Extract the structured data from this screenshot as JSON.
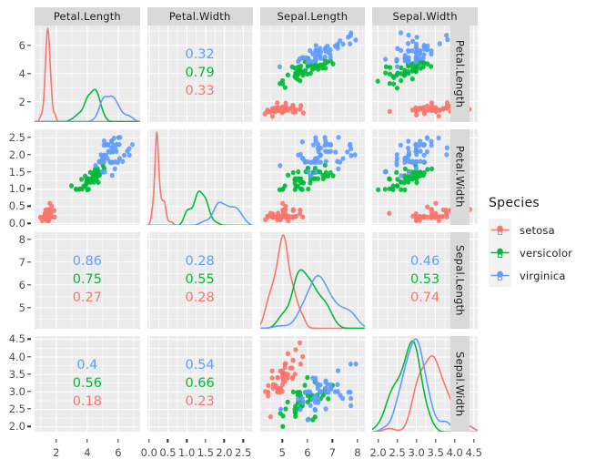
{
  "legend": {
    "title": "Species",
    "items": [
      {
        "label": "setosa",
        "color": "#F8766D"
      },
      {
        "label": "versicolor",
        "color": "#00BA38"
      },
      {
        "label": "virginica",
        "color": "#619CFF"
      }
    ]
  },
  "colors": {
    "setosa": "#F8766D",
    "versicolor": "#00BA38",
    "virginica": "#619CFF",
    "panel_bg": "#EBEBEB",
    "strip_bg": "#D9D9D9",
    "gridline": "#FFFFFF",
    "axis_text": "#4D4D4D"
  },
  "strips": {
    "columns": [
      "Petal.Length",
      "Petal.Width",
      "Sepal.Length",
      "Sepal.Width"
    ],
    "rows": [
      "Petal.Length",
      "Petal.Width",
      "Sepal.Length",
      "Sepal.Width"
    ]
  },
  "axes": {
    "x": [
      {
        "var": "Petal.Length",
        "ticks": [
          "2",
          "4",
          "6"
        ],
        "values": [
          2,
          4,
          6
        ],
        "range": [
          0.6,
          7.4
        ]
      },
      {
        "var": "Petal.Width",
        "ticks": [
          "0.0",
          "0.5",
          "1.0",
          "1.5",
          "2.0",
          "2.5"
        ],
        "values": [
          0.0,
          0.5,
          1.0,
          1.5,
          2.0,
          2.5
        ],
        "range": [
          -0.05,
          2.75
        ]
      },
      {
        "var": "Sepal.Length",
        "ticks": [
          "5",
          "6",
          "7",
          "8"
        ],
        "values": [
          5,
          6,
          7,
          8
        ],
        "range": [
          4.1,
          8.3
        ]
      },
      {
        "var": "Sepal.Width",
        "ticks": [
          "2.0",
          "2.5",
          "3.0",
          "3.5",
          "4.0",
          "4.5"
        ],
        "values": [
          2.0,
          2.5,
          3.0,
          3.5,
          4.0,
          4.5
        ],
        "range": [
          1.85,
          4.6
        ]
      }
    ],
    "y": [
      {
        "var": "Petal.Length",
        "ticks": [
          "2",
          "4",
          "6"
        ],
        "values": [
          2,
          4,
          6
        ],
        "range": [
          0.6,
          7.4
        ]
      },
      {
        "var": "Petal.Width",
        "ticks": [
          "0.0",
          "0.5",
          "1.0",
          "1.5",
          "2.0",
          "2.5"
        ],
        "values": [
          0.0,
          0.5,
          1.0,
          1.5,
          2.0,
          2.5
        ],
        "range": [
          -0.05,
          2.75
        ]
      },
      {
        "var": "Sepal.Length",
        "ticks": [
          "5",
          "6",
          "7",
          "8"
        ],
        "values": [
          5,
          6,
          7,
          8
        ],
        "range": [
          4.1,
          8.3
        ]
      },
      {
        "var": "Sepal.Width",
        "ticks": [
          "2.0",
          "2.5",
          "3.0",
          "3.5",
          "4.0",
          "4.5"
        ],
        "values": [
          2.0,
          2.5,
          3.0,
          3.5,
          4.0,
          4.5
        ],
        "range": [
          1.85,
          4.6
        ]
      }
    ]
  },
  "chart_data": {
    "type": "scatter",
    "title": "",
    "subtitle": "",
    "xlabel": "",
    "ylabel": "",
    "layout": "scatterplot-matrix",
    "grid": true,
    "legend_position": "right",
    "variables": [
      "Petal.Length",
      "Petal.Width",
      "Sepal.Length",
      "Sepal.Width"
    ],
    "groups": [
      "setosa",
      "versicolor",
      "virginica"
    ],
    "panels": [
      {
        "row": 1,
        "col": 1,
        "kind": "density",
        "variable": "Petal.Length"
      },
      {
        "row": 1,
        "col": 2,
        "kind": "correlation",
        "x": "Petal.Width",
        "y": "Petal.Length",
        "values": [
          {
            "group": "virginica",
            "text": "0.32"
          },
          {
            "group": "versicolor",
            "text": "0.79"
          },
          {
            "group": "setosa",
            "text": "0.33"
          }
        ]
      },
      {
        "row": 1,
        "col": 3,
        "kind": "scatter",
        "x": "Sepal.Length",
        "y": "Petal.Length"
      },
      {
        "row": 1,
        "col": 4,
        "kind": "scatter",
        "x": "Sepal.Width",
        "y": "Petal.Length"
      },
      {
        "row": 2,
        "col": 1,
        "kind": "scatter",
        "x": "Petal.Length",
        "y": "Petal.Width"
      },
      {
        "row": 2,
        "col": 2,
        "kind": "density",
        "variable": "Petal.Width"
      },
      {
        "row": 2,
        "col": 3,
        "kind": "scatter",
        "x": "Sepal.Length",
        "y": "Petal.Width"
      },
      {
        "row": 2,
        "col": 4,
        "kind": "scatter",
        "x": "Sepal.Width",
        "y": "Petal.Width"
      },
      {
        "row": 3,
        "col": 1,
        "kind": "correlation",
        "x": "Petal.Length",
        "y": "Sepal.Length",
        "values": [
          {
            "group": "virginica",
            "text": "0.86"
          },
          {
            "group": "versicolor",
            "text": "0.75"
          },
          {
            "group": "setosa",
            "text": "0.27"
          }
        ]
      },
      {
        "row": 3,
        "col": 2,
        "kind": "correlation",
        "x": "Petal.Width",
        "y": "Sepal.Length",
        "values": [
          {
            "group": "virginica",
            "text": "0.28"
          },
          {
            "group": "versicolor",
            "text": "0.55"
          },
          {
            "group": "setosa",
            "text": "0.28"
          }
        ]
      },
      {
        "row": 3,
        "col": 3,
        "kind": "density",
        "variable": "Sepal.Length"
      },
      {
        "row": 3,
        "col": 4,
        "kind": "correlation",
        "x": "Sepal.Width",
        "y": "Sepal.Length",
        "values": [
          {
            "group": "virginica",
            "text": "0.46"
          },
          {
            "group": "versicolor",
            "text": "0.53"
          },
          {
            "group": "setosa",
            "text": "0.74"
          }
        ]
      },
      {
        "row": 4,
        "col": 1,
        "kind": "correlation",
        "x": "Petal.Length",
        "y": "Sepal.Width",
        "values": [
          {
            "group": "virginica",
            "text": "0.4"
          },
          {
            "group": "versicolor",
            "text": "0.56"
          },
          {
            "group": "setosa",
            "text": "0.18"
          }
        ]
      },
      {
        "row": 4,
        "col": 2,
        "kind": "correlation",
        "x": "Petal.Width",
        "y": "Sepal.Width",
        "values": [
          {
            "group": "virginica",
            "text": "0.54"
          },
          {
            "group": "versicolor",
            "text": "0.66"
          },
          {
            "group": "setosa",
            "text": "0.23"
          }
        ]
      },
      {
        "row": 4,
        "col": 3,
        "kind": "scatter",
        "x": "Sepal.Length",
        "y": "Sepal.Width"
      },
      {
        "row": 4,
        "col": 4,
        "kind": "density",
        "variable": "Sepal.Width"
      }
    ],
    "points": {
      "Sepal.Length": [
        5.1,
        4.9,
        4.7,
        4.6,
        5.0,
        5.4,
        4.6,
        5.0,
        4.4,
        4.9,
        5.4,
        4.8,
        4.8,
        4.3,
        5.8,
        5.7,
        5.4,
        5.1,
        5.7,
        5.1,
        5.4,
        5.1,
        4.6,
        5.1,
        4.8,
        5.0,
        5.0,
        5.2,
        5.2,
        4.7,
        4.8,
        5.4,
        5.2,
        5.5,
        4.9,
        5.0,
        5.5,
        4.9,
        4.4,
        5.1,
        5.0,
        4.5,
        4.4,
        5.0,
        5.1,
        4.8,
        5.1,
        4.6,
        5.3,
        5.0,
        7.0,
        6.4,
        6.9,
        5.5,
        6.5,
        5.7,
        6.3,
        4.9,
        6.6,
        5.2,
        5.0,
        5.9,
        6.0,
        6.1,
        5.6,
        6.7,
        5.6,
        5.8,
        6.2,
        5.6,
        5.9,
        6.1,
        6.3,
        6.1,
        6.4,
        6.6,
        6.8,
        6.7,
        6.0,
        5.7,
        5.5,
        5.5,
        5.8,
        6.0,
        5.4,
        6.0,
        6.7,
        6.3,
        5.6,
        5.5,
        5.5,
        6.1,
        5.8,
        5.0,
        5.6,
        5.7,
        5.7,
        6.2,
        5.1,
        5.7,
        6.3,
        5.8,
        7.1,
        6.3,
        6.5,
        7.6,
        4.9,
        7.3,
        6.7,
        7.2,
        6.5,
        6.4,
        6.8,
        5.7,
        5.8,
        6.4,
        6.5,
        7.7,
        7.7,
        6.0,
        6.9,
        5.6,
        7.7,
        6.3,
        6.7,
        7.2,
        6.2,
        6.1,
        6.4,
        7.2,
        7.4,
        7.9,
        6.4,
        6.3,
        6.1,
        7.7,
        6.3,
        6.4,
        6.0,
        6.9,
        6.7,
        6.9,
        5.8,
        6.8,
        6.7,
        6.7,
        6.3,
        6.5,
        6.2,
        5.9
      ],
      "Sepal.Width": [
        3.5,
        3.0,
        3.2,
        3.1,
        3.6,
        3.9,
        3.4,
        3.4,
        2.9,
        3.1,
        3.7,
        3.4,
        3.0,
        3.0,
        4.0,
        4.4,
        3.9,
        3.5,
        3.8,
        3.8,
        3.4,
        3.7,
        3.6,
        3.3,
        3.4,
        3.0,
        3.4,
        3.5,
        3.4,
        3.2,
        3.1,
        3.4,
        4.1,
        4.2,
        3.1,
        3.2,
        3.5,
        3.6,
        3.0,
        3.4,
        3.5,
        2.3,
        3.2,
        3.5,
        3.8,
        3.0,
        3.8,
        3.2,
        3.7,
        3.3,
        3.2,
        3.2,
        3.1,
        2.3,
        2.8,
        2.8,
        3.3,
        2.4,
        2.9,
        2.7,
        2.0,
        3.0,
        2.2,
        2.9,
        2.9,
        3.1,
        3.0,
        2.7,
        2.2,
        2.5,
        3.2,
        2.8,
        2.5,
        2.8,
        2.9,
        3.0,
        2.8,
        3.0,
        2.9,
        2.6,
        2.4,
        2.4,
        2.7,
        2.7,
        3.0,
        3.4,
        3.1,
        2.3,
        3.0,
        2.5,
        2.6,
        3.0,
        2.6,
        2.3,
        2.7,
        3.0,
        2.9,
        2.9,
        2.5,
        2.8,
        3.3,
        2.7,
        3.0,
        2.9,
        3.0,
        3.0,
        2.5,
        2.9,
        2.5,
        3.6,
        3.2,
        2.7,
        3.0,
        2.5,
        2.8,
        3.2,
        3.0,
        3.8,
        2.6,
        2.2,
        3.2,
        2.8,
        2.8,
        2.7,
        3.3,
        3.2,
        2.8,
        3.0,
        2.8,
        3.0,
        2.8,
        3.8,
        2.8,
        2.8,
        2.6,
        3.0,
        3.4,
        3.1,
        3.0,
        3.1,
        3.1,
        3.1,
        2.7,
        3.2,
        3.3,
        3.0,
        2.5,
        3.0,
        3.4,
        3.0
      ],
      "Petal.Length": [
        1.4,
        1.4,
        1.3,
        1.5,
        1.4,
        1.7,
        1.4,
        1.5,
        1.4,
        1.5,
        1.5,
        1.6,
        1.4,
        1.1,
        1.2,
        1.5,
        1.3,
        1.4,
        1.7,
        1.5,
        1.7,
        1.5,
        1.0,
        1.7,
        1.9,
        1.6,
        1.6,
        1.5,
        1.4,
        1.6,
        1.6,
        1.5,
        1.5,
        1.4,
        1.5,
        1.2,
        1.3,
        1.4,
        1.3,
        1.5,
        1.3,
        1.3,
        1.3,
        1.6,
        1.9,
        1.4,
        1.6,
        1.4,
        1.5,
        1.4,
        4.7,
        4.5,
        4.9,
        4.0,
        4.6,
        4.5,
        4.7,
        3.3,
        4.6,
        3.9,
        3.5,
        4.2,
        4.0,
        4.7,
        3.6,
        4.4,
        4.5,
        4.1,
        4.5,
        3.9,
        4.8,
        4.0,
        4.9,
        4.7,
        4.3,
        4.4,
        4.8,
        5.0,
        4.5,
        3.5,
        3.8,
        3.7,
        3.9,
        5.1,
        4.5,
        4.5,
        4.7,
        4.4,
        4.1,
        4.0,
        4.4,
        4.6,
        4.0,
        3.3,
        4.2,
        4.2,
        4.2,
        4.3,
        3.0,
        4.1,
        6.0,
        5.1,
        5.9,
        5.6,
        5.8,
        6.6,
        4.5,
        6.3,
        5.8,
        6.1,
        5.1,
        5.3,
        5.5,
        5.0,
        5.1,
        5.3,
        5.5,
        6.7,
        6.9,
        5.0,
        5.7,
        4.9,
        6.7,
        4.9,
        5.7,
        6.0,
        4.8,
        4.9,
        5.6,
        5.8,
        6.1,
        6.4,
        5.6,
        5.1,
        5.6,
        6.1,
        5.6,
        5.5,
        4.8,
        5.4,
        5.6,
        5.1,
        5.1,
        5.9,
        5.7,
        5.2,
        5.0,
        5.2,
        5.4,
        5.1
      ],
      "Petal.Width": [
        0.2,
        0.2,
        0.2,
        0.2,
        0.2,
        0.4,
        0.3,
        0.2,
        0.2,
        0.1,
        0.2,
        0.2,
        0.1,
        0.1,
        0.2,
        0.4,
        0.4,
        0.3,
        0.3,
        0.3,
        0.2,
        0.4,
        0.2,
        0.5,
        0.2,
        0.2,
        0.4,
        0.2,
        0.2,
        0.2,
        0.2,
        0.4,
        0.1,
        0.2,
        0.2,
        0.2,
        0.2,
        0.1,
        0.2,
        0.2,
        0.3,
        0.3,
        0.2,
        0.6,
        0.4,
        0.3,
        0.2,
        0.2,
        0.2,
        0.2,
        1.4,
        1.5,
        1.5,
        1.3,
        1.5,
        1.3,
        1.6,
        1.0,
        1.3,
        1.4,
        1.0,
        1.5,
        1.0,
        1.4,
        1.3,
        1.4,
        1.5,
        1.0,
        1.5,
        1.1,
        1.8,
        1.3,
        1.5,
        1.2,
        1.3,
        1.4,
        1.4,
        1.7,
        1.5,
        1.0,
        1.1,
        1.0,
        1.2,
        1.6,
        1.5,
        1.6,
        1.5,
        1.3,
        1.3,
        1.3,
        1.2,
        1.4,
        1.2,
        1.0,
        1.3,
        1.2,
        1.3,
        1.3,
        1.1,
        1.3,
        2.5,
        1.9,
        2.1,
        1.8,
        2.2,
        2.1,
        1.7,
        1.8,
        1.8,
        2.5,
        2.0,
        1.9,
        2.1,
        2.0,
        2.4,
        2.3,
        1.8,
        2.2,
        2.3,
        1.5,
        2.3,
        2.0,
        2.0,
        1.8,
        2.1,
        1.8,
        1.8,
        1.8,
        2.1,
        1.6,
        1.9,
        2.0,
        2.2,
        1.5,
        1.4,
        2.3,
        2.4,
        1.8,
        1.8,
        2.1,
        2.4,
        2.3,
        1.9,
        2.3,
        2.5,
        2.3,
        1.9,
        2.0,
        2.3,
        1.8
      ],
      "Species": [
        "setosa",
        "versicolor",
        "virginica"
      ],
      "group_sizes": [
        50,
        50,
        50
      ]
    },
    "density_stats": {
      "Petal.Length": {
        "setosa": {
          "mean": 1.46,
          "sd": 0.17
        },
        "versicolor": {
          "mean": 4.26,
          "sd": 0.47
        },
        "virginica": {
          "mean": 5.55,
          "sd": 0.55
        }
      },
      "Petal.Width": {
        "setosa": {
          "mean": 0.25,
          "sd": 0.11
        },
        "versicolor": {
          "mean": 1.33,
          "sd": 0.2
        },
        "virginica": {
          "mean": 2.03,
          "sd": 0.27
        }
      },
      "Sepal.Length": {
        "setosa": {
          "mean": 5.01,
          "sd": 0.35
        },
        "versicolor": {
          "mean": 5.94,
          "sd": 0.52
        },
        "virginica": {
          "mean": 6.59,
          "sd": 0.64
        }
      },
      "Sepal.Width": {
        "setosa": {
          "mean": 3.43,
          "sd": 0.38
        },
        "versicolor": {
          "mean": 2.77,
          "sd": 0.31
        },
        "virginica": {
          "mean": 2.97,
          "sd": 0.32
        }
      }
    }
  }
}
